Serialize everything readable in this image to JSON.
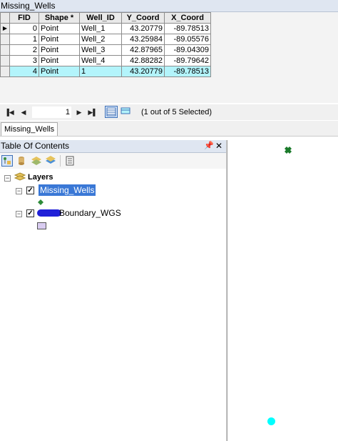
{
  "attribute_table": {
    "title": "Missing_Wells",
    "columns": [
      "FID",
      "Shape *",
      "Well_ID",
      "Y_Coord",
      "X_Coord"
    ],
    "rows": [
      {
        "fid": "0",
        "shape": "Point",
        "well_id": "Well_1",
        "y": "43.20779",
        "x": "-89.78513"
      },
      {
        "fid": "1",
        "shape": "Point",
        "well_id": "Well_2",
        "y": "43.25984",
        "x": "-89.05576"
      },
      {
        "fid": "2",
        "shape": "Point",
        "well_id": "Well_3",
        "y": "42.87965",
        "x": "-89.04309"
      },
      {
        "fid": "3",
        "shape": "Point",
        "well_id": "Well_4",
        "y": "42.88282",
        "x": "-89.79642"
      },
      {
        "fid": "4",
        "shape": "Point",
        "well_id": "1",
        "y": "43.20779",
        "x": "-89.78513"
      }
    ],
    "selected_row_index": 4,
    "selected_row_color": "#b3f4fb"
  },
  "navigation": {
    "current_record": "1",
    "status": "(1 out of 5 Selected)"
  },
  "tabs": [
    "Missing_Wells"
  ],
  "toc": {
    "title": "Table Of Contents",
    "root_label": "Layers",
    "layers": [
      {
        "name": "Missing_Wells",
        "checked": true,
        "highlighted": true,
        "symbol": "green-point-icon"
      },
      {
        "name": "Boundary_WGS",
        "checked": true,
        "highlighted": false,
        "symbol": "lavender-polygon-swatch"
      }
    ]
  },
  "map": {
    "point_color_default": "#1a7a2a",
    "point_color_selected": "#00ffff"
  }
}
